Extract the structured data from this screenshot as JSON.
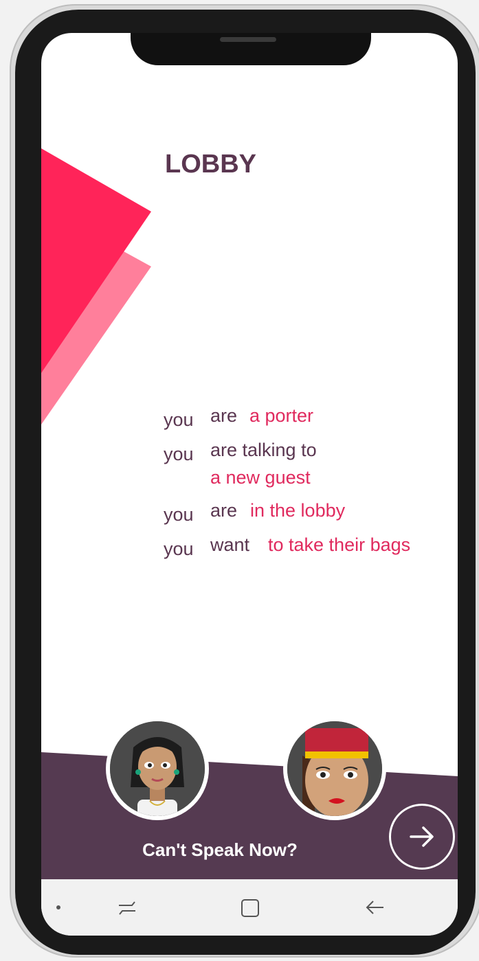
{
  "screen": {
    "title": "LOBBY"
  },
  "scenario": {
    "lines": [
      {
        "subject": "you",
        "verb": "are",
        "role": "a porter"
      },
      {
        "subject": "you",
        "verb": "are talking to",
        "role": "a new guest"
      },
      {
        "subject": "you",
        "verb": "are",
        "role": "in the lobby"
      },
      {
        "subject": "you",
        "verb": "want",
        "role": "to take their bags"
      }
    ]
  },
  "footer": {
    "cant_speak_label": "Can't Speak Now?",
    "next_icon": "arrow-right-icon"
  },
  "avatars": [
    {
      "name": "guest-avatar",
      "icon": "woman-avatar"
    },
    {
      "name": "porter-avatar",
      "icon": "porter-avatar"
    }
  ],
  "navbar": {
    "items": [
      "dot",
      "recent-apps-icon",
      "home-icon",
      "back-icon"
    ]
  },
  "colors": {
    "accent": "#e02a5e",
    "accent_light": "#ff7f9b",
    "deco_red": "#ff2459",
    "primary_text": "#5a3650",
    "band": "#553a51",
    "navbar": "#f1f1f1"
  }
}
